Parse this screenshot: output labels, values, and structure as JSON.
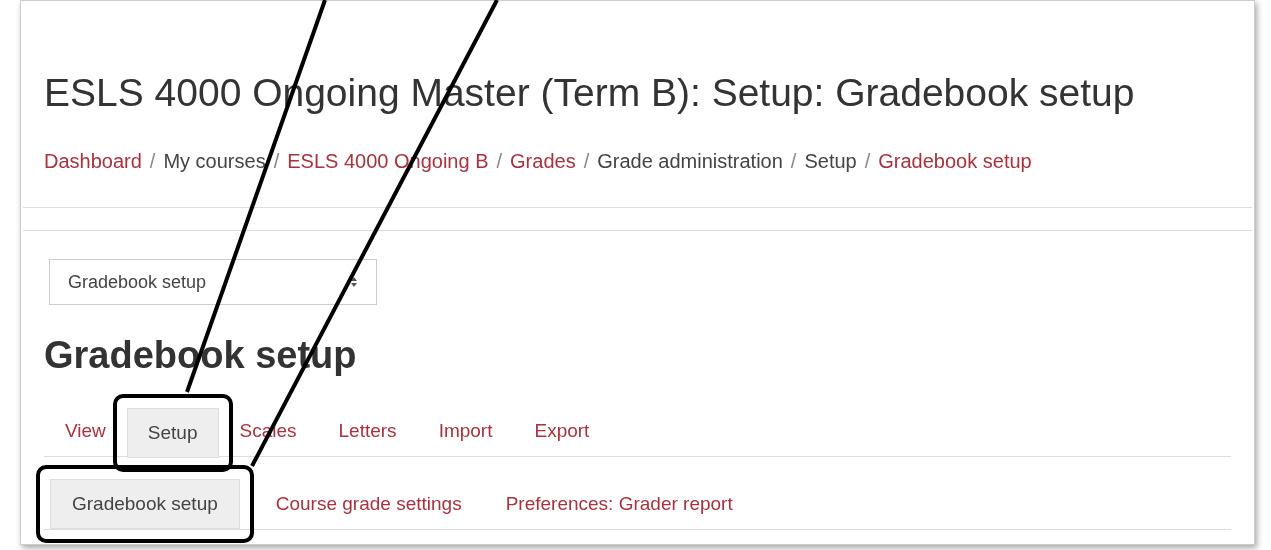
{
  "page_title": "ESLS 4000 Ongoing Master (Term B): Setup: Gradebook setup",
  "breadcrumbs": [
    {
      "label": "Dashboard",
      "link": true
    },
    {
      "separator": "/",
      "label": "My courses",
      "link": false
    },
    {
      "separator": "/",
      "label": "ESLS 4000 Ongoing B",
      "link": true
    },
    {
      "separator": "/",
      "label": "Grades",
      "link": true
    },
    {
      "separator": "/",
      "label": "Grade administration",
      "link": false
    },
    {
      "separator": "/",
      "label": "Setup",
      "link": false
    },
    {
      "separator": "/",
      "label": "Gradebook setup",
      "link": true
    }
  ],
  "select": {
    "value": "Gradebook setup"
  },
  "heading": "Gradebook setup",
  "tabs": [
    {
      "label": "View",
      "selected": false,
      "highlighted": false
    },
    {
      "label": "Setup",
      "selected": true,
      "highlighted": true
    },
    {
      "label": "Scales",
      "selected": false,
      "highlighted": false
    },
    {
      "label": "Letters",
      "selected": false,
      "highlighted": false
    },
    {
      "label": "Import",
      "selected": false,
      "highlighted": false
    },
    {
      "label": "Export",
      "selected": false,
      "highlighted": false
    }
  ],
  "subtabs": [
    {
      "label": "Gradebook setup",
      "selected": true,
      "highlighted": true
    },
    {
      "label": "Course grade settings",
      "selected": false,
      "highlighted": false
    },
    {
      "label": "Preferences: Grader report",
      "selected": false,
      "highlighted": false
    }
  ]
}
